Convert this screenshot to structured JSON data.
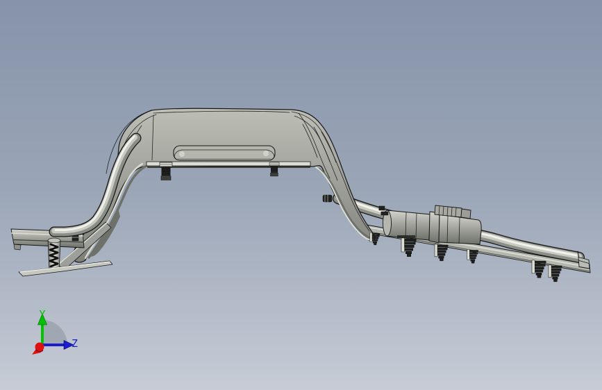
{
  "viewport": {
    "width": "867",
    "height": "562",
    "background_top": "#8693a9",
    "background_mid": "#9ba6b7",
    "background_bottom": "#c7ccd6"
  },
  "triad": {
    "y_label": "Y",
    "z_label": "Z",
    "y_axis_color": "#00c400",
    "z_axis_color": "#1c1ccd",
    "origin_color": "#e01010",
    "origin_dark": "#8c0f0f",
    "arc_color": "#99a1ab"
  },
  "model": {
    "body_light": "#bdbfb7",
    "body_mid": "#a3a59e",
    "body_dark": "#7e8079",
    "inner_shadow": "#6e716a",
    "edge_color": "#161616",
    "flange_light": "#dcded4",
    "tube_base": "#8b8e86",
    "tube_light": "#c9cbc3",
    "tube_highlight": "#f1f2ec",
    "clip_dark": "#20221f",
    "clip_mid": "#3c3e38",
    "metal_light": "#d4d6ce"
  }
}
